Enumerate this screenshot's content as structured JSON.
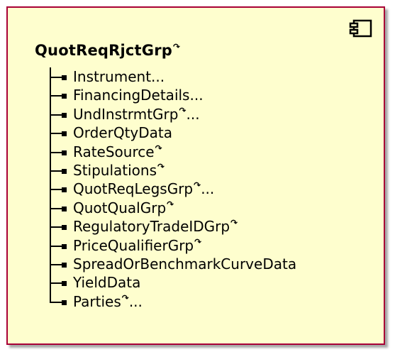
{
  "component": {
    "icon": "component-icon",
    "title": "QuotReqRjctGrp",
    "title_repeat_mark": "↷",
    "border_color": "#a80036",
    "fill_color": "#fefece"
  },
  "items": [
    {
      "label": "Instrument",
      "repeat": false,
      "ellipsis": "..."
    },
    {
      "label": "FinancingDetails",
      "repeat": false,
      "ellipsis": "..."
    },
    {
      "label": "UndInstrmtGrp",
      "repeat": true,
      "ellipsis": "..."
    },
    {
      "label": "OrderQtyData",
      "repeat": false,
      "ellipsis": ""
    },
    {
      "label": "RateSource",
      "repeat": true,
      "ellipsis": ""
    },
    {
      "label": "Stipulations",
      "repeat": true,
      "ellipsis": ""
    },
    {
      "label": "QuotReqLegsGrp",
      "repeat": true,
      "ellipsis": "..."
    },
    {
      "label": "QuotQualGrp",
      "repeat": true,
      "ellipsis": ""
    },
    {
      "label": "RegulatoryTradeIDGrp",
      "repeat": true,
      "ellipsis": ""
    },
    {
      "label": "PriceQualifierGrp",
      "repeat": true,
      "ellipsis": ""
    },
    {
      "label": "SpreadOrBenchmarkCurveData",
      "repeat": false,
      "ellipsis": ""
    },
    {
      "label": "YieldData",
      "repeat": false,
      "ellipsis": ""
    },
    {
      "label": "Parties",
      "repeat": true,
      "ellipsis": "..."
    }
  ]
}
